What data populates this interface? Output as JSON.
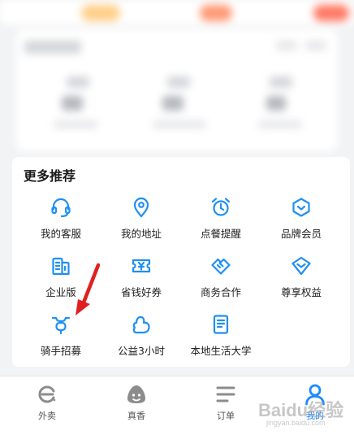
{
  "more_recommend": {
    "title": "更多推荐",
    "items": [
      {
        "label": "我的客服",
        "icon": "headset-icon"
      },
      {
        "label": "我的地址",
        "icon": "location-pin-icon"
      },
      {
        "label": "点餐提醒",
        "icon": "alarm-clock-icon"
      },
      {
        "label": "品牌会员",
        "icon": "brand-shield-icon"
      },
      {
        "label": "企业版",
        "icon": "building-icon"
      },
      {
        "label": "省钱好券",
        "icon": "coupon-icon"
      },
      {
        "label": "商务合作",
        "icon": "handshake-icon"
      },
      {
        "label": "尊享权益",
        "icon": "diamond-icon"
      },
      {
        "label": "骑手招募",
        "icon": "rider-scooter-icon"
      },
      {
        "label": "公益3小时",
        "icon": "charity-hand-icon"
      },
      {
        "label": "本地生活大学",
        "icon": "book-icon"
      }
    ]
  },
  "tabbar": {
    "tabs": [
      {
        "label": "外卖",
        "icon": "takeout-logo-icon",
        "active": false
      },
      {
        "label": "真香",
        "icon": "rice-ball-icon",
        "active": false
      },
      {
        "label": "订单",
        "icon": "order-list-icon",
        "active": false
      },
      {
        "label": "我的",
        "icon": "profile-icon",
        "active": true
      }
    ]
  },
  "watermark": {
    "main": "Baidu经验",
    "sub": "jingyan.baidu.com"
  },
  "colors": {
    "accent": "#1a8cff",
    "icon_blue": "#1f8ff2",
    "annotation_red": "#e02020"
  }
}
